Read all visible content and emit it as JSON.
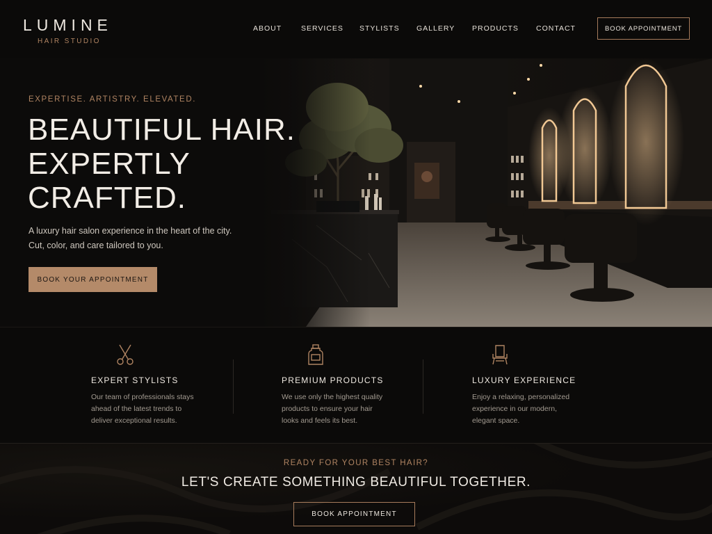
{
  "brand": {
    "name": "LUMINE",
    "tagline": "HAIR STUDIO"
  },
  "nav": {
    "items": [
      "ABOUT",
      "SERVICES",
      "STYLISTS",
      "GALLERY",
      "PRODUCTS",
      "CONTACT"
    ],
    "cta_label": "BOOK APPOINTMENT"
  },
  "hero": {
    "eyebrow": "EXPERTISE. ARTISTRY. ELEVATED.",
    "headline_lines": [
      "BEAUTIFUL HAIR.",
      "EXPERTLY",
      "CRAFTED."
    ],
    "subtext_lines": [
      "A luxury hair salon experience in the heart of the city.",
      "Cut, color, and care tailored to you."
    ],
    "button_label": "BOOK YOUR APPOINTMENT"
  },
  "features": [
    {
      "icon": "scissors-icon",
      "title": "EXPERT STYLISTS",
      "lines": [
        "Our team of professionals stays",
        "ahead of the latest trends to",
        "deliver exceptional results."
      ]
    },
    {
      "icon": "product-bottle-icon",
      "title": "PREMIUM PRODUCTS",
      "lines": [
        "We use only the highest quality",
        "products to ensure your hair",
        "looks and feels its best."
      ]
    },
    {
      "icon": "salon-chair-icon",
      "title": "LUXURY EXPERIENCE",
      "lines": [
        "Enjoy a relaxing, personalized",
        "experience in our modern,",
        "elegant space."
      ]
    }
  ],
  "cta": {
    "eyebrow": "READY FOR YOUR BEST HAIR?",
    "title": "LET'S CREATE SOMETHING BEAUTIFUL TOGETHER.",
    "button_label": "BOOK APPOINTMENT"
  },
  "colors": {
    "background": "#0b0a09",
    "accent": "#b08462",
    "button_fill": "#b48a69",
    "text": "#efe9e1"
  }
}
